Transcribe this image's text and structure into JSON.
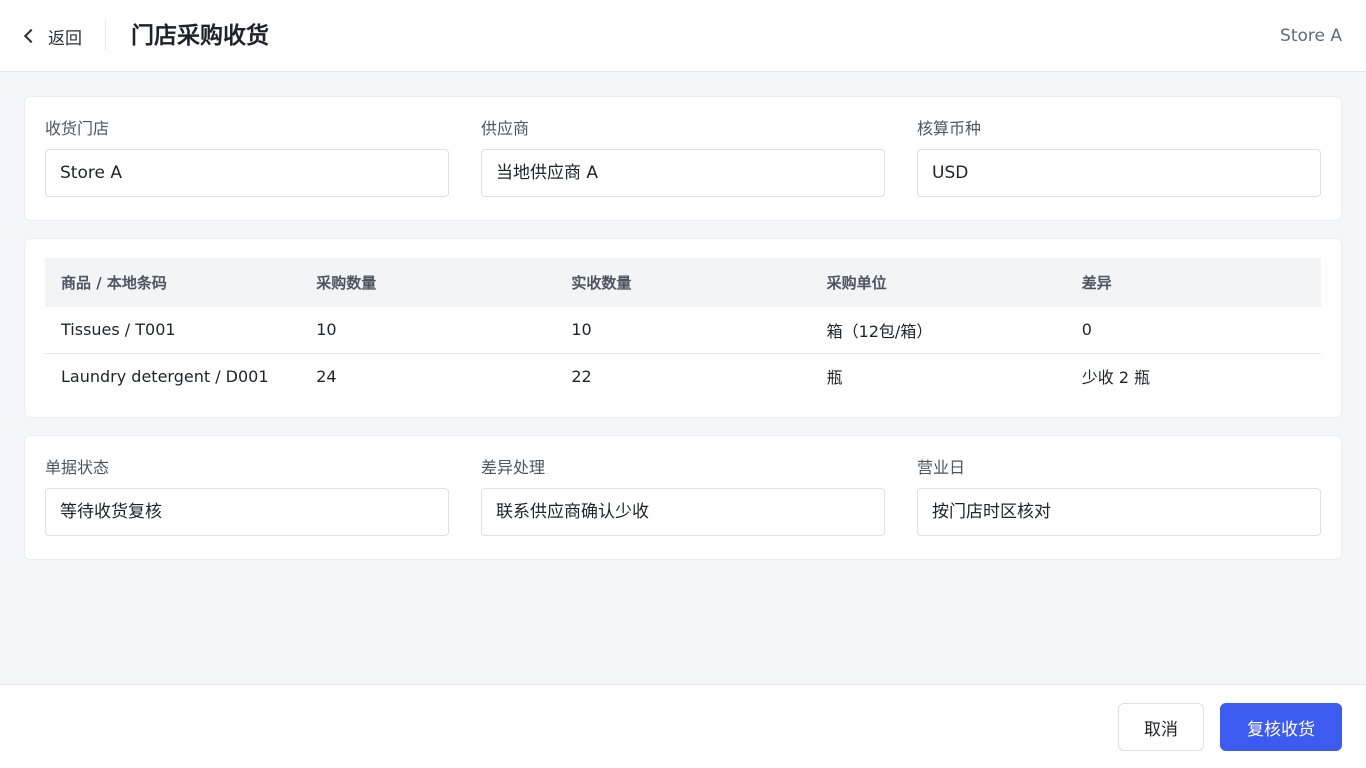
{
  "header": {
    "back_label": "返回",
    "title": "门店采购收货",
    "store": "Store A"
  },
  "form_top": {
    "store_label": "收货门店",
    "store_value": "Store A",
    "supplier_label": "供应商",
    "supplier_value": "当地供应商 A",
    "currency_label": "核算币种",
    "currency_value": "USD"
  },
  "table": {
    "columns": [
      "商品 / 本地条码",
      "采购数量",
      "实收数量",
      "采购单位",
      "差异"
    ],
    "rows": [
      [
        "Tissues / T001",
        "10",
        "10",
        "箱（12包/箱）",
        "0"
      ],
      [
        "Laundry detergent / D001",
        "24",
        "22",
        "瓶",
        "少收 2 瓶"
      ]
    ]
  },
  "form_bottom": {
    "status_label": "单据状态",
    "status_value": "等待收货复核",
    "diff_label": "差异处理",
    "diff_value": "联系供应商确认少收",
    "bizday_label": "营业日",
    "bizday_value": "按门店时区核对"
  },
  "footer": {
    "cancel_label": "取消",
    "confirm_label": "复核收货"
  },
  "colors": {
    "primary": "#3d5af1",
    "background": "#f4f6f9"
  },
  "icons": {
    "back": "chevron-left-icon"
  }
}
